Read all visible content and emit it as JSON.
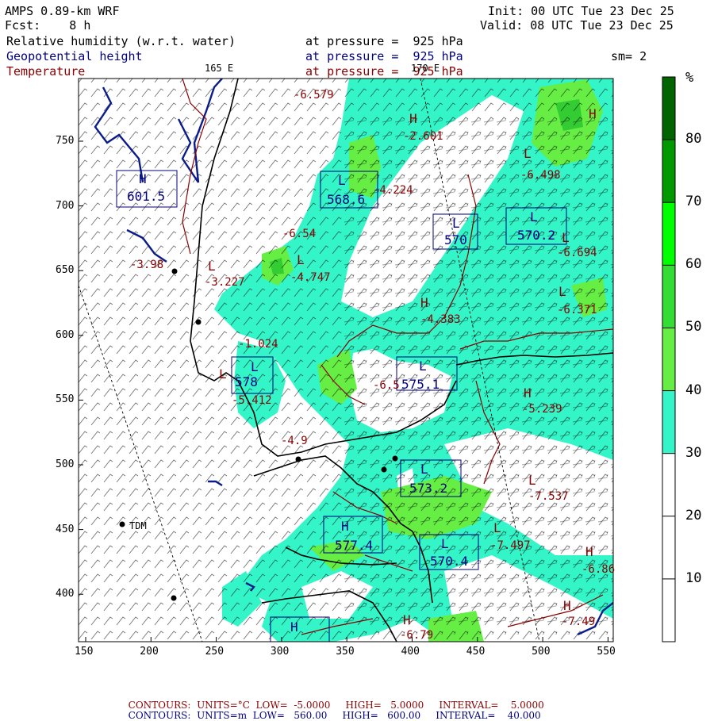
{
  "header": {
    "model": "AMPS 0.89-km WRF",
    "forecast": "Fcst:    8 h",
    "init": "Init: 00 UTC Tue 23 Dec 25",
    "valid": "Valid: 08 UTC Tue 23 Dec 25",
    "fields": [
      {
        "name": "Relative humidity (w.r.t. water)",
        "level": "at pressure =  925 hPa",
        "color": "#000000"
      },
      {
        "name": "Geopotential height",
        "level": "at pressure =  925 hPa",
        "color": "#000080"
      },
      {
        "name": "Temperature",
        "level": "at pressure =  925 hPa",
        "color": "#8b0000"
      }
    ],
    "smoothing": "sm= 2",
    "meridian_label": "165 E",
    "meridian_label2": "170 E"
  },
  "colorbar": {
    "unit": "%",
    "ticks": [
      "80",
      "70",
      "60",
      "50",
      "40",
      "30",
      "20",
      "10"
    ],
    "bands": [
      {
        "from": 0,
        "to": 30,
        "color": "#ffffff"
      },
      {
        "from": 30,
        "to": 40,
        "color": "#33f5c8"
      },
      {
        "from": 40,
        "to": 50,
        "color": "#66ee44"
      },
      {
        "from": 50,
        "to": 60,
        "color": "#33dd33"
      },
      {
        "from": 60,
        "to": 70,
        "color": "#00ff00"
      },
      {
        "from": 70,
        "to": 80,
        "color": "#009900"
      },
      {
        "from": 80,
        "to": 90,
        "color": "#006400"
      }
    ]
  },
  "axes": {
    "x_ticks": [
      "150",
      "200",
      "250",
      "300",
      "350",
      "400",
      "450",
      "500",
      "550"
    ],
    "y_ticks": [
      "750",
      "700",
      "650",
      "600",
      "550",
      "500",
      "450",
      "400"
    ]
  },
  "map_labels": {
    "stations": [
      {
        "name": "TDM"
      }
    ],
    "height_lows": [
      "568.6",
      "570",
      "570.2",
      "578",
      "573.2",
      "577.4",
      "570.4",
      "575.1"
    ],
    "height_highs": [
      "601.5"
    ],
    "temp_values": [
      "-6.579",
      "-2.601",
      "-4.224",
      "-6.498",
      "-6.694",
      "-6.371",
      "-4.383",
      "-6.54",
      "-4.747",
      "-3.227",
      "-3.98",
      "-1.024",
      "-5.412",
      "-5.239",
      "-7.537",
      "-7.497",
      "-6.86",
      "-7.49",
      "-6.79",
      "-6.5",
      "-4.9"
    ]
  },
  "footer": {
    "line1": {
      "label": "CONTOURS:",
      "units": "UNITS=°C",
      "low": "LOW=  -5.0000",
      "high": "HIGH=   5.0000",
      "interval": "INTERVAL=    5.0000",
      "color": "#8b0000"
    },
    "line2": {
      "label": "CONTOURS:",
      "units": "UNITS=m",
      "low": "LOW=   560.00",
      "high": "HIGH=   600.00",
      "interval": "INTERVAL=    40.000",
      "color": "#000080"
    }
  }
}
